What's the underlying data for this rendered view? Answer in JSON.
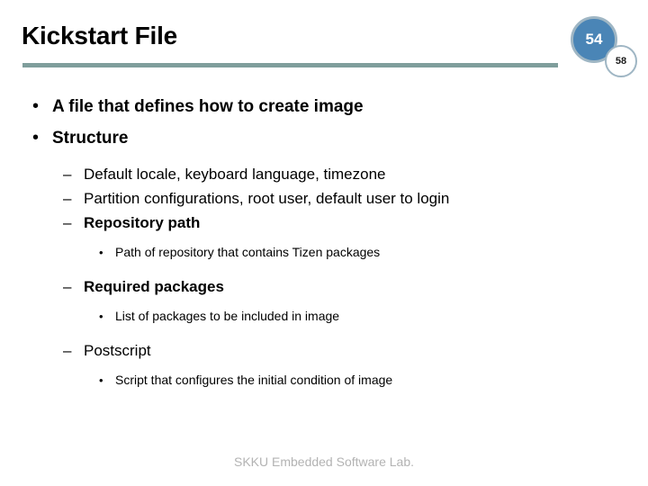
{
  "slide": {
    "title": "Kickstart File",
    "footer": "SKKU Embedded Software Lab.",
    "accent_rule_color": "#7f9e9c",
    "badge_fill_color": "#4a85b6",
    "badge_ring_color": "#9fb6c4",
    "footer_color": "#b3b3b3"
  },
  "badges": {
    "primary": "54",
    "secondary": "58"
  },
  "markers": {
    "level1": "•",
    "level2": "–",
    "level3": "•"
  },
  "bullets": [
    {
      "level": 1,
      "text": "A file that defines how to create image",
      "bold": true
    },
    {
      "level": 1,
      "text": "Structure",
      "bold": true
    },
    {
      "level": 2,
      "text": "Default locale, keyboard language, timezone",
      "bold": false
    },
    {
      "level": 2,
      "text": "Partition configurations, root user, default user to login",
      "bold": false
    },
    {
      "level": 2,
      "text": "Repository path",
      "bold": true
    },
    {
      "level": 3,
      "text": "Path of repository that contains Tizen packages",
      "bold": false
    },
    {
      "level": 2,
      "text": "Required packages",
      "bold": true
    },
    {
      "level": 3,
      "text": "List of packages to be included in image",
      "bold": false
    },
    {
      "level": 2,
      "text": "Postscript",
      "bold": false
    },
    {
      "level": 3,
      "text": "Script that configures the initial condition of image",
      "bold": false
    }
  ]
}
